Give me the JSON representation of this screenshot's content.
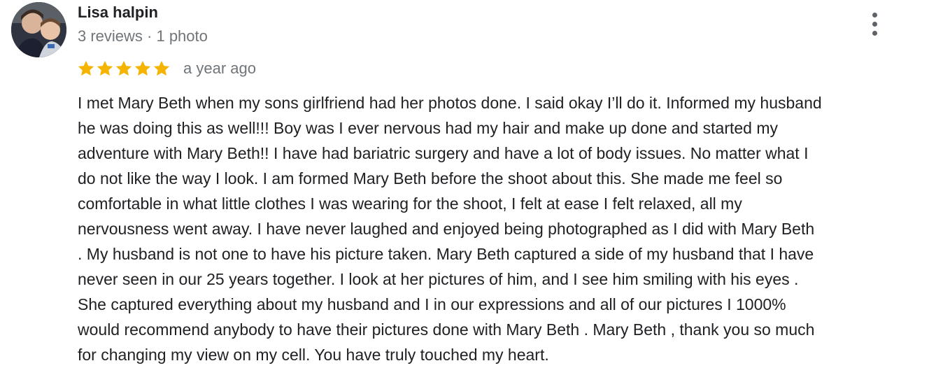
{
  "reviewer": {
    "name": "Lisa halpin",
    "meta": "3 reviews · 1 photo"
  },
  "rating": {
    "stars": 5,
    "max_stars": 5,
    "star_color": "#F4B400",
    "date": "a year ago"
  },
  "review": {
    "lines": [
      "I met Mary Beth when my sons girlfriend had her photos done. I said okay I’ll do it. Informed my husband",
      "he was doing this as well!!! Boy was I ever nervous had my hair and make up done and started my",
      "adventure with Mary Beth!!  I have had bariatric surgery and have a lot of body issues. No matter what I",
      "do not like the way I look. I am formed Mary Beth before the shoot about this. She made me feel so",
      "comfortable in what little clothes I was wearing for the shoot, I felt at ease I felt relaxed, all my",
      "nervousness went away. I have never laughed and enjoyed being photographed as I did with Mary Beth",
      ". My husband is not one to have his picture taken. Mary Beth captured a side of my husband that I have",
      "never seen in our 25 years together. I look at her pictures of him, and I see him smiling with his eyes .",
      "She captured everything about my husband and I in our expressions and all of our pictures I 1000%",
      "would recommend anybody to have their pictures done with Mary Beth . Mary Beth , thank you so much",
      "for changing my view on my cell. You have truly touched my heart."
    ]
  },
  "icons": {
    "avatar": "profile-photo",
    "more": "more-vertical-icon",
    "star": "star-icon"
  }
}
